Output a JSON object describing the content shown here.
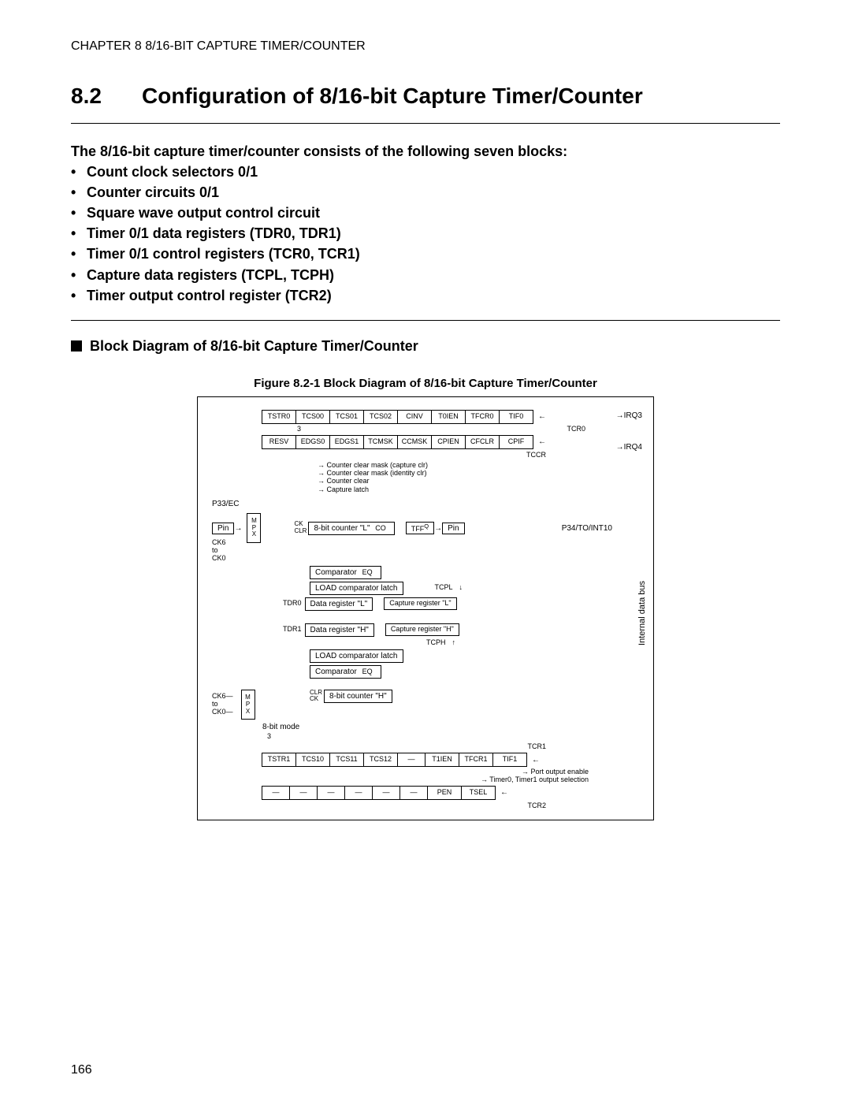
{
  "chapter_header": "CHAPTER 8  8/16-BIT CAPTURE TIMER/COUNTER",
  "section_number": "8.2",
  "section_title": "Configuration of 8/16-bit Capture Timer/Counter",
  "intro": "The 8/16-bit capture timer/counter consists of the following seven blocks:",
  "blocks": [
    "Count clock selectors 0/1",
    "Counter circuits 0/1",
    "Square wave output control circuit",
    "Timer 0/1 data registers (TDR0, TDR1)",
    "Timer 0/1 control registers (TCR0, TCR1)",
    "Capture data registers (TCPL, TCPH)",
    "Timer output control register (TCR2)"
  ],
  "subheading": "Block Diagram of 8/16-bit Capture Timer/Counter",
  "figure_caption": "Figure 8.2-1  Block Diagram of 8/16-bit Capture Timer/Counter",
  "diagram": {
    "tcr0_bits": [
      "TSTR0",
      "TCS00",
      "TCS01",
      "TCS02",
      "CINV",
      "T0IEN",
      "TFCR0",
      "TIF0"
    ],
    "tcr0_label": "TCR0",
    "tccr_bits": [
      "RESV",
      "EDGS0",
      "EDGS1",
      "TCMSK",
      "CCMSK",
      "CPIEN",
      "CFCLR",
      "CPIF"
    ],
    "tccr_label": "TCCR",
    "three_label": "3",
    "irq3": "IRQ3",
    "irq4": "IRQ4",
    "notes": [
      "Counter clear mask (capture clr)",
      "Counter clear mask (identity clr)",
      "Counter clear",
      "Capture latch"
    ],
    "pin_left_top": "P33/EC",
    "pin_label": "Pin",
    "mpx": "MPX",
    "ck_top_a": "CK6",
    "ck_top_b": "to",
    "ck_top_c": "CK0",
    "ck_label": "CK",
    "clr_label": "CLR",
    "counter_l": "8-bit counter \"L\"",
    "co_label": "CO",
    "tff": "TFF",
    "q_label": "Q",
    "pin_right_top": "P34/TO/INT10",
    "comparator": "Comparator",
    "eq_label": "EQ",
    "load_comp_latch": "LOAD comparator latch",
    "tdr0": "TDR0",
    "data_reg_l": "Data register \"L\"",
    "tcpl": "TCPL",
    "cap_reg_l": "Capture register \"L\"",
    "tdr1": "TDR1",
    "data_reg_h": "Data register \"H\"",
    "tcph": "TCPH",
    "cap_reg_h": "Capture register \"H\"",
    "counter_h": "8-bit counter \"H\"",
    "mode8": "8-bit mode",
    "tcr1_bits": [
      "TSTR1",
      "TCS10",
      "TCS11",
      "TCS12",
      "—",
      "T1IEN",
      "TFCR1",
      "TIF1"
    ],
    "tcr1_label": "TCR1",
    "out_notes": [
      "Port output enable",
      "Timer0, Timer1 output selection"
    ],
    "tcr2_bits": [
      "—",
      "—",
      "—",
      "—",
      "—",
      "—",
      "PEN",
      "TSEL"
    ],
    "tcr2_label": "TCR2",
    "bus_label": "Internal data bus"
  },
  "page_number": "166"
}
